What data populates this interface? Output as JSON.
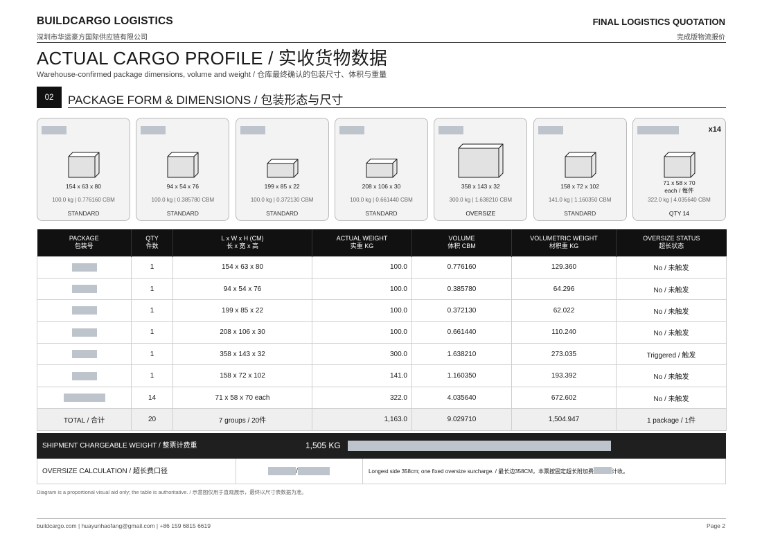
{
  "header": {
    "brand": "BUILDCARGO LOGISTICS",
    "brand_sub": "深圳市华运豪方国际供应链有限公司",
    "doc_title": "FINAL LOGISTICS QUOTATION",
    "doc_sub": "完成版物流报价"
  },
  "page": {
    "title": "ACTUAL CARGO PROFILE / 实收货物数据",
    "desc": "Warehouse-confirmed package dimensions, volume and weight / 仓库最终确认的包装尺寸、体积与重量"
  },
  "section": {
    "number": "02",
    "title": "PACKAGE FORM & DIMENSIONS / 包装形态与尺寸"
  },
  "colors": {
    "redaction": "#bec4cc",
    "header_bg": "#111111",
    "card_bg": "#f3f3f3"
  },
  "cards": [
    {
      "dims": "154 x 63 x 80",
      "dims2": "",
      "meta": "100.0 kg | 0.776160 CBM",
      "status": "STANDARD",
      "badge": "",
      "l": 154,
      "w": 63,
      "h": 80
    },
    {
      "dims": "94 x 54 x 76",
      "dims2": "",
      "meta": "100.0 kg | 0.385780 CBM",
      "status": "STANDARD",
      "badge": "",
      "l": 94,
      "w": 54,
      "h": 76
    },
    {
      "dims": "199 x 85 x 22",
      "dims2": "",
      "meta": "100.0 kg | 0.372130 CBM",
      "status": "STANDARD",
      "badge": "",
      "l": 199,
      "w": 85,
      "h": 22
    },
    {
      "dims": "208 x 106 x 30",
      "dims2": "",
      "meta": "100.0 kg | 0.661440 CBM",
      "status": "STANDARD",
      "badge": "",
      "l": 208,
      "w": 106,
      "h": 30
    },
    {
      "dims": "358 x 143 x 32",
      "dims2": "",
      "meta": "300.0 kg | 1.638210 CBM",
      "status": "OVERSIZE",
      "badge": "",
      "l": 358,
      "w": 143,
      "h": 32
    },
    {
      "dims": "158 x 72 x 102",
      "dims2": "",
      "meta": "141.0 kg | 1.160350 CBM",
      "status": "STANDARD",
      "badge": "",
      "l": 158,
      "w": 72,
      "h": 102
    },
    {
      "dims": "71 x 58 x 70",
      "dims2": "each / 每件",
      "meta": "322.0 kg | 4.035640 CBM",
      "status": "QTY 14",
      "badge": "x14",
      "l": 71,
      "w": 58,
      "h": 70
    }
  ],
  "table": {
    "headers": [
      {
        "en": "PACKAGE",
        "cn": "包装号"
      },
      {
        "en": "QTY",
        "cn": "件数"
      },
      {
        "en": "L x W x H (CM)",
        "cn": "长 x 宽 x 高"
      },
      {
        "en": "ACTUAL WEIGHT",
        "cn": "实重 KG"
      },
      {
        "en": "VOLUME",
        "cn": "体积 CBM"
      },
      {
        "en": "VOLUMETRIC WEIGHT",
        "cn": "材积重 KG"
      },
      {
        "en": "OVERSIZE STATUS",
        "cn": "超长状态"
      }
    ],
    "rows": [
      {
        "qty": "1",
        "dims": "154 x 63 x 80",
        "weight": "100.0",
        "volume": "0.776160",
        "volw": "129.360",
        "status": "No / 未触发"
      },
      {
        "qty": "1",
        "dims": "94 x 54 x 76",
        "weight": "100.0",
        "volume": "0.385780",
        "volw": "64.296",
        "status": "No / 未触发"
      },
      {
        "qty": "1",
        "dims": "199 x 85 x 22",
        "weight": "100.0",
        "volume": "0.372130",
        "volw": "62.022",
        "status": "No / 未触发"
      },
      {
        "qty": "1",
        "dims": "208 x 106 x 30",
        "weight": "100.0",
        "volume": "0.661440",
        "volw": "110.240",
        "status": "No / 未触发"
      },
      {
        "qty": "1",
        "dims": "358 x 143 x 32",
        "weight": "300.0",
        "volume": "1.638210",
        "volw": "273.035",
        "status": "Triggered / 触发"
      },
      {
        "qty": "1",
        "dims": "158 x 72 x 102",
        "weight": "141.0",
        "volume": "1.160350",
        "volw": "193.392",
        "status": "No / 未触发"
      },
      {
        "qty": "14",
        "dims": "71 x 58 x 70 each",
        "weight": "322.0",
        "volume": "4.035640",
        "volw": "672.602",
        "status": "No / 未触发"
      }
    ],
    "total": {
      "label": "TOTAL / 合计",
      "qty": "20",
      "dims": "7 groups / 20件",
      "weight": "1,163.0",
      "volume": "9.029710",
      "volw": "1,504.947",
      "status": "1 package / 1件"
    }
  },
  "chargeable": {
    "label": "SHIPMENT CHARGEABLE WEIGHT / 整票计费重",
    "value": "1,505 KG"
  },
  "oversize": {
    "label": "OVERSIZE CALCULATION / 超长费口径",
    "separator": "/",
    "note_pre": "Longest side 358cm; one fixed oversize surcharge. / 最长边358CM，本票按固定超长附加费",
    "note_post": "计收。"
  },
  "footnote": "Diagram is a proportional visual aid only; the table is authoritative. / 示意图仅用于直观展示，最终以尺寸表数据为准。",
  "footer": {
    "contact": "buildcargo.com  |  huayunhaofang@gmail.com  |  +86 159 6815 6619",
    "page": "Page 2"
  }
}
